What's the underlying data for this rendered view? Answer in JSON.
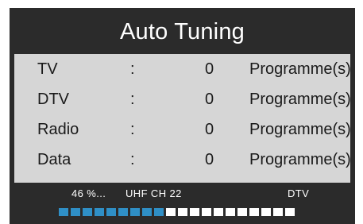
{
  "dialog": {
    "title": "Auto Tuning"
  },
  "results": [
    {
      "label": "TV",
      "separator": ":",
      "count": "0",
      "unit": "Programme(s)"
    },
    {
      "label": "DTV",
      "separator": ":",
      "count": "0",
      "unit": "Programme(s)"
    },
    {
      "label": "Radio",
      "separator": ":",
      "count": "0",
      "unit": "Programme(s)"
    },
    {
      "label": "Data",
      "separator": ":",
      "count": "0",
      "unit": "Programme(s)"
    }
  ],
  "status": {
    "percent_text": "46 %...",
    "channel": "UHF CH 22",
    "signal_type": "DTV"
  },
  "progress": {
    "fraction": 0.46,
    "filled_color": "#2f8fc6",
    "empty_color": "#ffffff"
  }
}
